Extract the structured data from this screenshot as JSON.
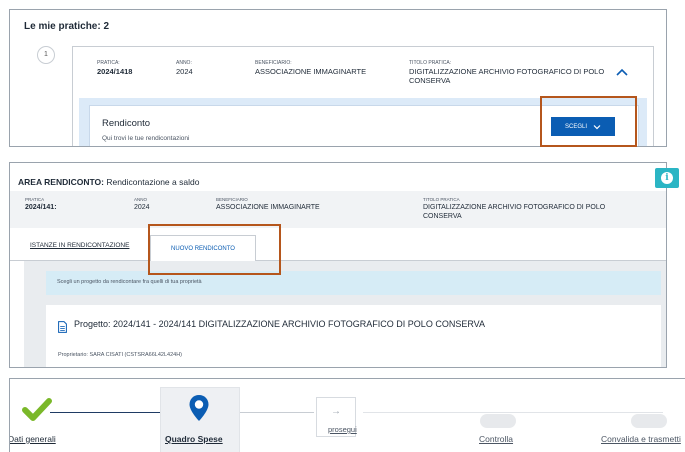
{
  "panel1": {
    "title": "Le mie pratiche: 2",
    "item_number": "1",
    "pratica": {
      "label": "PRATICA:",
      "value": "2024/1418"
    },
    "anno": {
      "label": "ANNO:",
      "value": "2024"
    },
    "beneficiario": {
      "label": "BENEFICIARIO:",
      "value": "ASSOCIAZIONE IMMAGINARTE"
    },
    "titolo": {
      "label": "TITOLO PRATICA:",
      "value": "DIGITALIZZAZIONE ARCHIVIO FOTOGRAFICO DI POLO CONSERVA"
    },
    "rendiconto": {
      "title": "Rendiconto",
      "subtitle": "Qui trovi le tue rendicontazioni",
      "button": "SCEGLI"
    },
    "highlight_color": "#b5561c"
  },
  "panel2": {
    "title_bold": "AREA RENDICONTO:",
    "title_rest": "Rendicontazione a saldo",
    "pratica": {
      "label": "PRATICA",
      "value": "2024/141:"
    },
    "anno": {
      "label": "ANNO",
      "value": "2024"
    },
    "beneficiario": {
      "label": "BENEFICIARIO",
      "value": "ASSOCIAZIONE IMMAGINARTE"
    },
    "titolo": {
      "label": "TITOLO PRATICA",
      "value": "DIGITALIZZAZIONE ARCHIVIO FOTOGRAFICO DI POLO CONSERVA"
    },
    "tabs": [
      "ISTANZE IN RENDICONTAZIONE",
      "NUOVO RENDICONTO"
    ],
    "alert": "Scegli un progetto da rendicontare fra quelli di tua proprietà",
    "project": {
      "label": "Progetto:",
      "title": "2024/141 - 2024/141  DIGITALIZZAZIONE ARCHIVIO FOTOGRAFICO DI POLO CONSERVA",
      "owner": "Proprietario: SARA CISATI (CSTSRA66L42L424H)"
    },
    "info_icon": "i"
  },
  "panel3": {
    "steps": [
      "Dati generali",
      "Quadro Spese",
      "Controlla",
      "Convalida e trasmetti"
    ],
    "next_label": "prosegui",
    "next_arrow": "→",
    "accent": "#0b5db3",
    "check_color": "#7ab829"
  }
}
